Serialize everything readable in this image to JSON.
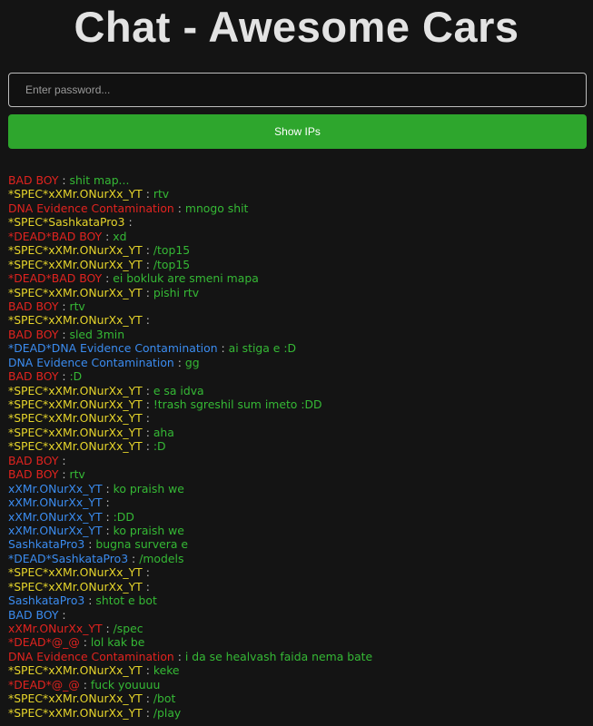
{
  "page": {
    "title": "Chat - Awesome Cars",
    "password_placeholder": "Enter password...",
    "show_ips_label": "Show IPs"
  },
  "colors": {
    "red": "#e1231f",
    "yellow": "#e6d52b",
    "blue": "#3b8cf0",
    "message_text": "#35b935",
    "button_green": "#2ea62d"
  },
  "separator": ":",
  "messages": [
    {
      "name": "BAD BOY",
      "color": "red",
      "text": "shit map..."
    },
    {
      "name": "*SPEC*xXMr.ONurXx_YT",
      "color": "yellow",
      "text": "rtv"
    },
    {
      "name": "DNA Evidence Contamination",
      "color": "red",
      "text": "mnogo shit"
    },
    {
      "name": "*SPEC*SashkataPro3",
      "color": "yellow",
      "text": ""
    },
    {
      "name": "*DEAD*BAD BOY",
      "color": "red",
      "text": "xd"
    },
    {
      "name": "*SPEC*xXMr.ONurXx_YT",
      "color": "yellow",
      "text": "/top15"
    },
    {
      "name": "*SPEC*xXMr.ONurXx_YT",
      "color": "yellow",
      "text": "/top15"
    },
    {
      "name": "*DEAD*BAD BOY",
      "color": "red",
      "text": "ei bokluk are smeni mapa"
    },
    {
      "name": "*SPEC*xXMr.ONurXx_YT",
      "color": "yellow",
      "text": "pishi rtv"
    },
    {
      "name": "BAD BOY",
      "color": "red",
      "text": "rtv"
    },
    {
      "name": "*SPEC*xXMr.ONurXx_YT",
      "color": "yellow",
      "text": ""
    },
    {
      "name": "BAD BOY",
      "color": "red",
      "text": "sled 3min"
    },
    {
      "name": "*DEAD*DNA Evidence Contamination",
      "color": "blue",
      "text": "ai stiga e :D"
    },
    {
      "name": "DNA Evidence Contamination",
      "color": "blue",
      "text": "gg"
    },
    {
      "name": "BAD BOY",
      "color": "red",
      "text": ":D"
    },
    {
      "name": "*SPEC*xXMr.ONurXx_YT",
      "color": "yellow",
      "text": "e sa idva"
    },
    {
      "name": "*SPEC*xXMr.ONurXx_YT",
      "color": "yellow",
      "text": "!trash sgreshil sum imeto :DD"
    },
    {
      "name": "*SPEC*xXMr.ONurXx_YT",
      "color": "yellow",
      "text": ""
    },
    {
      "name": "*SPEC*xXMr.ONurXx_YT",
      "color": "yellow",
      "text": "aha"
    },
    {
      "name": "*SPEC*xXMr.ONurXx_YT",
      "color": "yellow",
      "text": ":D"
    },
    {
      "name": "BAD BOY",
      "color": "red",
      "text": ""
    },
    {
      "name": "BAD BOY",
      "color": "red",
      "text": "rtv"
    },
    {
      "name": "xXMr.ONurXx_YT",
      "color": "blue",
      "text": "ko praish we"
    },
    {
      "name": "xXMr.ONurXx_YT",
      "color": "blue",
      "text": ""
    },
    {
      "name": "xXMr.ONurXx_YT",
      "color": "blue",
      "text": ":DD"
    },
    {
      "name": "xXMr.ONurXx_YT",
      "color": "blue",
      "text": "ko praish we"
    },
    {
      "name": "SashkataPro3",
      "color": "blue",
      "text": "bugna survera e"
    },
    {
      "name": "*DEAD*SashkataPro3",
      "color": "blue",
      "text": "/models"
    },
    {
      "name": "*SPEC*xXMr.ONurXx_YT",
      "color": "yellow",
      "text": ""
    },
    {
      "name": "*SPEC*xXMr.ONurXx_YT",
      "color": "yellow",
      "text": ""
    },
    {
      "name": "SashkataPro3",
      "color": "blue",
      "text": "shtot e bot"
    },
    {
      "name": "BAD BOY",
      "color": "blue",
      "text": ""
    },
    {
      "name": "xXMr.ONurXx_YT",
      "color": "red",
      "text": "/spec"
    },
    {
      "name": "*DEAD*@_@",
      "color": "red",
      "text": "lol kak be"
    },
    {
      "name": "DNA Evidence Contamination",
      "color": "red",
      "text": "i da se healvash faida nema bate"
    },
    {
      "name": "*SPEC*xXMr.ONurXx_YT",
      "color": "yellow",
      "text": "keke"
    },
    {
      "name": "*DEAD*@_@",
      "color": "red",
      "text": "fuck youuuu"
    },
    {
      "name": "*SPEC*xXMr.ONurXx_YT",
      "color": "yellow",
      "text": "/bot"
    },
    {
      "name": "*SPEC*xXMr.ONurXx_YT",
      "color": "yellow",
      "text": "/play"
    }
  ]
}
